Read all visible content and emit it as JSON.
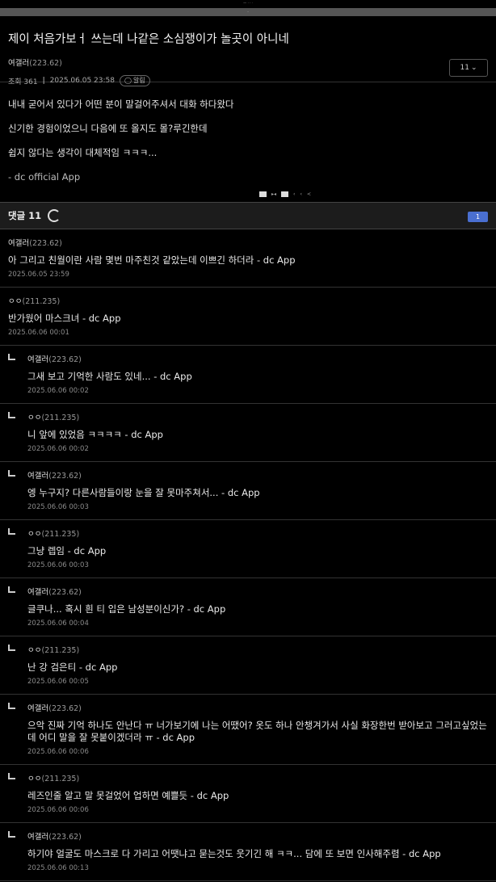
{
  "header": {
    "tiny_text": "— · · ·",
    "strip_text": "·"
  },
  "post": {
    "title": "제이 처음가보ㅓ 쓰는데 나같은 소심쟁이가 놀곳이 아니네",
    "author": "여갤러",
    "author_ip": "(223.62)",
    "views": "조회 361",
    "date": "2025.06.05 23:58",
    "alarm_label": "알림",
    "page_select": "11",
    "body": [
      "내내 굳어서 있다가 어떤 분이 말걸어주셔서 대화 하다왔다",
      "신기한 경험이었으니 다음에 또 올지도 몰?루긴한데",
      "쉽지 않다는 생각이 대체적임 ㅋㅋㅋ..."
    ],
    "signature": "- dc official App"
  },
  "comments_header": {
    "label": "댓글 11",
    "badge": "1"
  },
  "comments": [
    {
      "nick": "여갤러",
      "ip": "(223.62)",
      "text": "아 그리고 친월이란 사람 몇번 마주친것 같았는데 이쁘긴 하더라 - dc App",
      "date": "2025.06.05 23:59",
      "reply": false
    },
    {
      "nick": "ㅇㅇ",
      "ip": "(211.235)",
      "text": "반가웠어 마스크녀 - dc App",
      "date": "2025.06.06 00:01",
      "reply": false
    },
    {
      "nick": "여갤러",
      "ip": "(223.62)",
      "text": "그새 보고 기억한 사람도 있네... - dc App",
      "date": "2025.06.06 00:02",
      "reply": true
    },
    {
      "nick": "ㅇㅇ",
      "ip": "(211.235)",
      "text": "니 앞에 있었음 ㅋㅋㅋㅋ - dc App",
      "date": "2025.06.06 00:02",
      "reply": true
    },
    {
      "nick": "여갤러",
      "ip": "(223.62)",
      "text": "엥 누구지? 다른사람들이랑 눈을 잘 못마주쳐서... - dc App",
      "date": "2025.06.06 00:03",
      "reply": true
    },
    {
      "nick": "ㅇㅇ",
      "ip": "(211.235)",
      "text": "그냥 렙임 - dc App",
      "date": "2025.06.06 00:03",
      "reply": true
    },
    {
      "nick": "여갤러",
      "ip": "(223.62)",
      "text": "글쿠나... 혹시 흰 티 입은 남성분이신가? - dc App",
      "date": "2025.06.06 00:04",
      "reply": true
    },
    {
      "nick": "ㅇㅇ",
      "ip": "(211.235)",
      "text": "난 강 검은티 - dc App",
      "date": "2025.06.06 00:05",
      "reply": true
    },
    {
      "nick": "여갤러",
      "ip": "(223.62)",
      "text": "으악 진짜 기억 하나도 안난다 ㅠ 너가보기에 나는 어땠어? 옷도 하나 안챙겨가서 사실 화장한번 받아보고 그러고싶었는데 어디 말을 잘 못붙이겠더라 ㅠ - dc App",
      "date": "2025.06.06 00:06",
      "reply": true,
      "tall": true
    },
    {
      "nick": "ㅇㅇ",
      "ip": "(211.235)",
      "text": "레즈인줄 알고 말 못걸었어 업하면 예쁠듯 - dc App",
      "date": "2025.06.06 00:06",
      "reply": true
    },
    {
      "nick": "여갤러",
      "ip": "(223.62)",
      "text": "하기야 얼굴도 마스크로 다 가리고 어땟냐고 묻는것도 웃기긴 해 ㅋㅋ... 담에 또 보면 인사해주렴 - dc App",
      "date": "2025.06.06 00:13",
      "reply": true
    }
  ]
}
